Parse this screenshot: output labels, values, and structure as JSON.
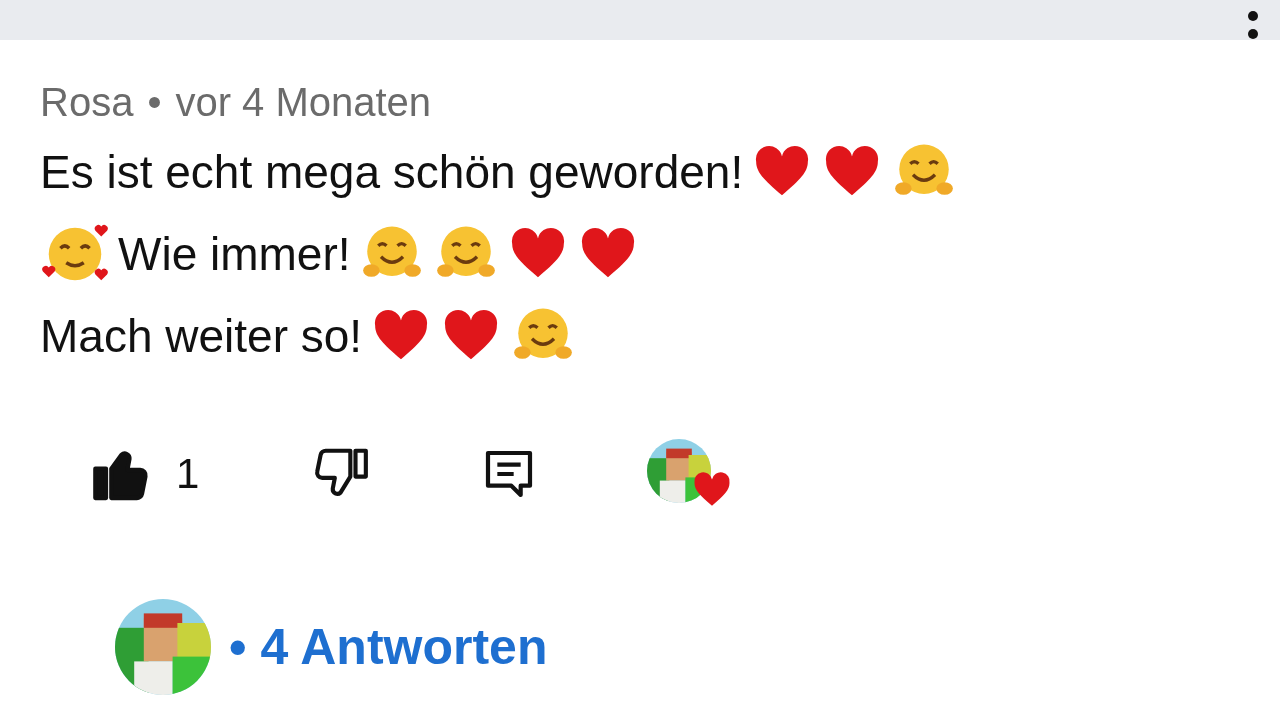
{
  "comment": {
    "author": "Rosa",
    "separator": "•",
    "time": "vor 4 Monaten",
    "lines": [
      [
        {
          "kind": "text",
          "text": "Es ist echt mega schön geworden!"
        },
        {
          "kind": "heart"
        },
        {
          "kind": "heart"
        },
        {
          "kind": "hug"
        }
      ],
      [
        {
          "kind": "love-face"
        },
        {
          "kind": "text",
          "text": "Wie immer!"
        },
        {
          "kind": "hug"
        },
        {
          "kind": "hug"
        },
        {
          "kind": "heart"
        },
        {
          "kind": "heart"
        }
      ],
      [
        {
          "kind": "text",
          "text": "Mach weiter so!"
        },
        {
          "kind": "heart"
        },
        {
          "kind": "heart"
        },
        {
          "kind": "hug"
        }
      ]
    ],
    "likes": "1",
    "liked": true,
    "creator_heart": true,
    "replies": {
      "separator": "•",
      "label": "4 Antworten"
    }
  }
}
